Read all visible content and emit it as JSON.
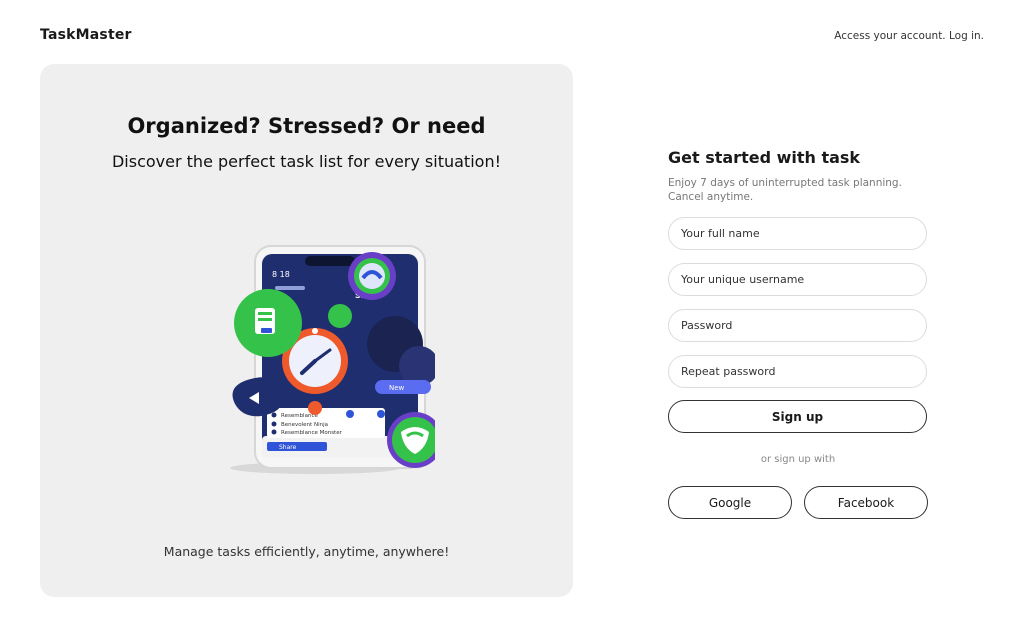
{
  "header": {
    "logo": "TaskMaster",
    "login_link": "Access your account. Log in."
  },
  "hero": {
    "title": "Organized? Stressed? Or need",
    "subtitle": "Discover the perfect task list for every situation!",
    "caption": "Manage tasks efficiently, anytime, anywhere!",
    "illustration": {
      "phone_time": "8 18",
      "phone_badge": "SSN",
      "list_row_1": "Resemblance",
      "list_row_2": "Benevolent Ninja",
      "list_row_3": "Resemblance Monster",
      "bottom_bar_label": "Share",
      "chip_label": "New",
      "icons": [
        "calendar-badge-icon",
        "checklist-icon",
        "clock-icon",
        "shield-check-icon",
        "cloud-icon",
        "chat-bubble-icon"
      ]
    }
  },
  "signup": {
    "title": "Get started with task",
    "subtitle": "Enjoy 7 days of uninterrupted task planning. Cancel anytime.",
    "fields": {
      "full_name": "Your full name",
      "username": "Your unique username",
      "password": "Password",
      "repeat_password": "Repeat password"
    },
    "submit_label": "Sign up",
    "alt_text": "or sign up with",
    "google_label": "Google",
    "facebook_label": "Facebook"
  },
  "colors": {
    "panel_bg": "#efefef",
    "phone_screen": "#1f2e6e",
    "accent_green": "#35c24a",
    "accent_orange": "#ef5a2c",
    "accent_purple": "#6a3fc8"
  }
}
